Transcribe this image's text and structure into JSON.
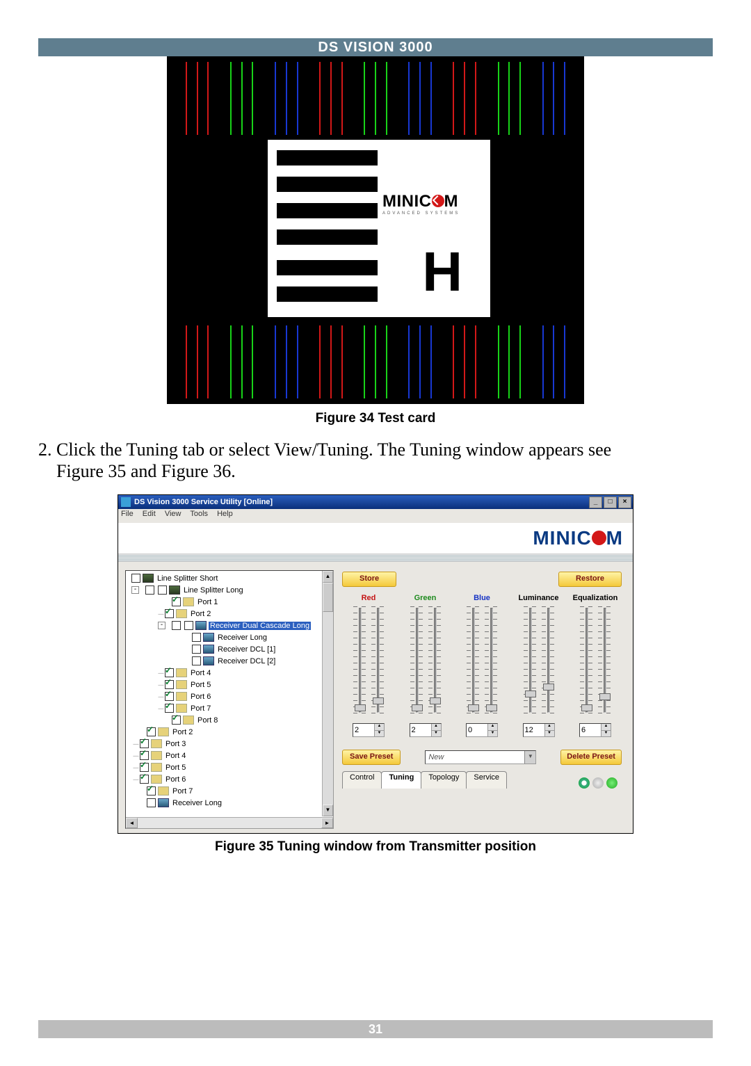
{
  "header": "DS VISION 3000",
  "fig34_caption": "Figure 34 Test card",
  "fig34_brand": "MINIC",
  "fig34_brand2": "M",
  "fig34_sub": "ADVANCED SYSTEMS",
  "fig34_letter": "H",
  "body_step_num": "2.",
  "body_step_line1": "Click the Tuning tab or select View/Tuning. The Tuning window appears see",
  "body_step_line2": "Figure 35 and Figure 36.",
  "fig35_caption": "Figure 35 Tuning window from Transmitter position",
  "page_number": "31",
  "shot": {
    "title": "DS Vision 3000 Service Utility [Online]",
    "win_min": "_",
    "win_max": "□",
    "win_close": "×",
    "menu": {
      "file": "File",
      "edit": "Edit",
      "view": "View",
      "tools": "Tools",
      "help": "Help"
    },
    "brand_main": "MINIC",
    "brand_tail": "M",
    "tree": [
      {
        "indent": 8,
        "pm": "",
        "cb": "off",
        "ico": "card",
        "label": "Line Splitter Short"
      },
      {
        "indent": 8,
        "pm": "-",
        "cb": "off",
        "ico": "card",
        "label": "Line Splitter Long",
        "aux": "2"
      },
      {
        "indent": 66,
        "cb": "off",
        "ico": "port",
        "checked": true,
        "label": "Port 1"
      },
      {
        "indent": 46,
        "dash": "----",
        "cb": "off",
        "ico": "port",
        "checked": true,
        "label": "Port 2"
      },
      {
        "indent": 46,
        "pm": "-",
        "aux": "2",
        "cb": "off",
        "ico": "rx",
        "label": "Receiver Dual Cascade Long",
        "sel": true
      },
      {
        "indent": 95,
        "cb": "off",
        "ico": "rx",
        "label": "Receiver Long"
      },
      {
        "indent": 95,
        "cb": "off",
        "ico": "rx",
        "label": "Receiver DCL [1]"
      },
      {
        "indent": 95,
        "cb": "off",
        "ico": "rx",
        "label": "Receiver DCL [2]"
      },
      {
        "indent": 46,
        "dash": "----",
        "cb": "off",
        "ico": "port",
        "checked": true,
        "label": "Port 4"
      },
      {
        "indent": 46,
        "dash": "----",
        "cb": "off",
        "ico": "port",
        "checked": true,
        "label": "Port 5"
      },
      {
        "indent": 46,
        "dash": "----",
        "cb": "off",
        "ico": "port",
        "checked": true,
        "label": "Port 6"
      },
      {
        "indent": 46,
        "dash": "----",
        "cb": "off",
        "ico": "port",
        "checked": true,
        "label": "Port 7"
      },
      {
        "indent": 66,
        "cb": "off",
        "ico": "port",
        "checked": true,
        "label": "Port 8"
      },
      {
        "indent": 30,
        "cb": "off",
        "ico": "port",
        "checked": true,
        "label": "Port 2"
      },
      {
        "indent": 10,
        "dash": "----",
        "cb": "off",
        "ico": "port",
        "checked": true,
        "label": "Port 3"
      },
      {
        "indent": 10,
        "dash": "----",
        "cb": "off",
        "ico": "port",
        "checked": true,
        "label": "Port 4"
      },
      {
        "indent": 10,
        "dash": "----",
        "cb": "off",
        "ico": "port",
        "checked": true,
        "label": "Port 5"
      },
      {
        "indent": 10,
        "dash": "----",
        "cb": "off",
        "ico": "port",
        "checked": true,
        "label": "Port 6"
      },
      {
        "indent": 30,
        "cb": "off",
        "ico": "port",
        "checked": true,
        "label": "Port 7"
      },
      {
        "indent": 30,
        "cb": "off",
        "ico": "rx",
        "label": "Receiver Long"
      }
    ],
    "buttons": {
      "store": "Store",
      "restore": "Restore",
      "save_preset": "Save Preset",
      "delete_preset": "Delete Preset"
    },
    "columns": {
      "red": "Red",
      "green": "Green",
      "blue": "Blue",
      "lum": "Luminance",
      "eq": "Equalization"
    },
    "values": {
      "red": "2",
      "green": "2",
      "blue": "0",
      "lum": "12",
      "eq": "6"
    },
    "preset_value": "New",
    "tabs": {
      "control": "Control",
      "tuning": "Tuning",
      "topology": "Topology",
      "service": "Service"
    }
  }
}
